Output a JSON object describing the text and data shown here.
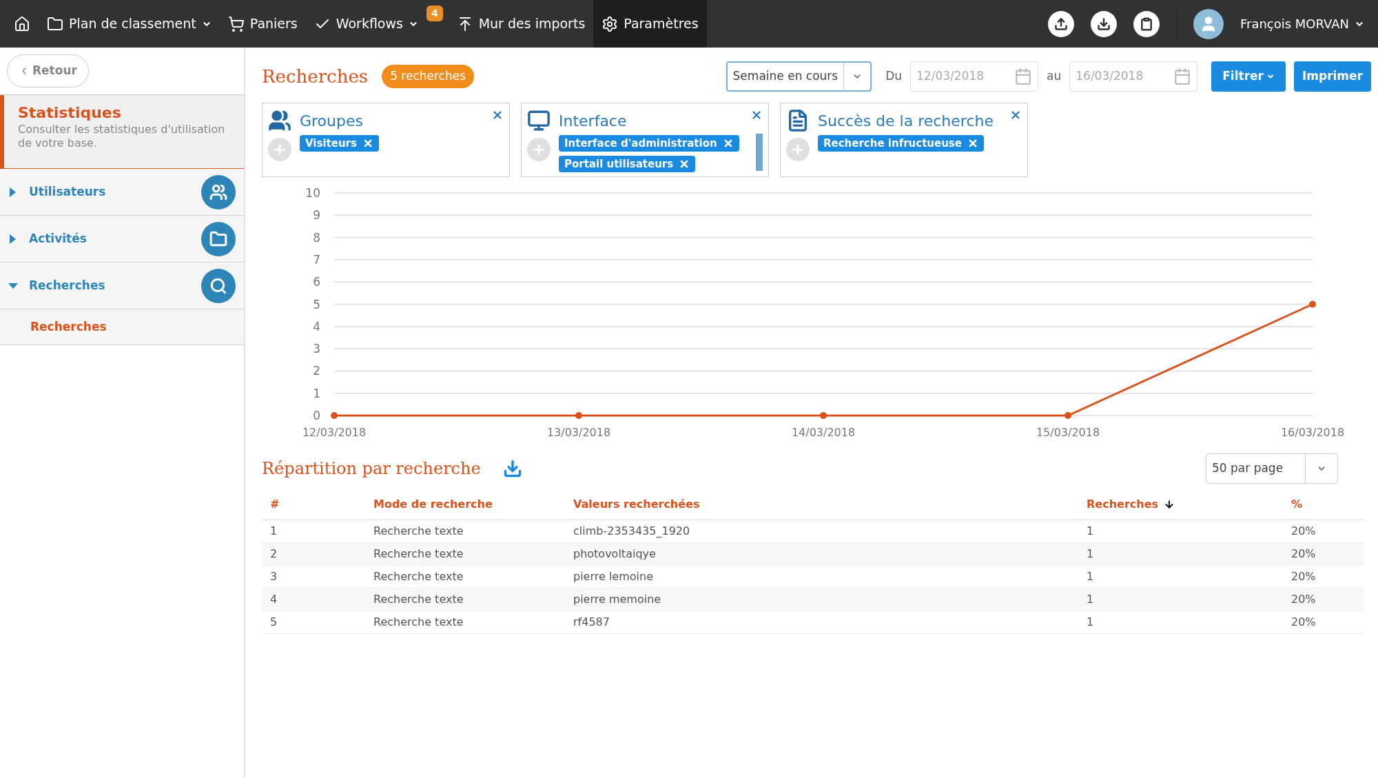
{
  "nav": {
    "items": [
      {
        "dropdown": false
      },
      {
        "label": "Plan de classement",
        "dropdown": true
      },
      {
        "label": "Paniers",
        "dropdown": false
      },
      {
        "label": "Workflows",
        "dropdown": true,
        "badge": "4"
      },
      {
        "label": "Mur des imports",
        "dropdown": false
      },
      {
        "label": "Paramètres",
        "dropdown": false,
        "selected": true
      }
    ],
    "user": "François MORVAN"
  },
  "sidebar": {
    "back": "Retour",
    "title": "Statistiques",
    "subtitle": "Consulter les statistiques d'utilisation de votre base.",
    "items": [
      {
        "label": "Utilisateurs",
        "expanded": false
      },
      {
        "label": "Activités",
        "expanded": false
      },
      {
        "label": "Recherches",
        "expanded": true,
        "children": [
          {
            "label": "Recherches",
            "selected": true
          }
        ]
      }
    ]
  },
  "header": {
    "title": "Recherches",
    "count": "5 recherches",
    "period": "Semaine en cours",
    "from_label": "Du",
    "from": "12/03/2018",
    "to_label": "au",
    "to": "16/03/2018",
    "filter": "Filtrer",
    "print": "Imprimer"
  },
  "filters": [
    {
      "title": "Groupes",
      "tags": [
        "Visiteurs"
      ]
    },
    {
      "title": "Interface",
      "tags": [
        "Interface d'administration",
        "Portail utilisateurs"
      ]
    },
    {
      "title": "Succès de la recherche",
      "tags": [
        "Recherche infructueuse"
      ]
    }
  ],
  "chart_data": {
    "type": "line",
    "grid": true,
    "categories": [
      "12/03/2018",
      "13/03/2018",
      "14/03/2018",
      "15/03/2018",
      "16/03/2018"
    ],
    "series": [
      {
        "color": "#d9531e",
        "marker": true,
        "values": [
          0,
          0,
          0,
          0,
          5
        ]
      }
    ],
    "ylim": [
      0,
      10
    ],
    "yticks": [
      0,
      1,
      2,
      3,
      4,
      5,
      6,
      7,
      8,
      9,
      10
    ]
  },
  "table": {
    "title": "Répartition par recherche",
    "page_size": "50 par page",
    "columns": [
      "#",
      "Mode de recherche",
      "Valeurs recherchées",
      "Recherches",
      "%"
    ],
    "rows": [
      [
        "1",
        "Recherche texte",
        "climb-2353435_1920",
        "1",
        "20%"
      ],
      [
        "2",
        "Recherche texte",
        "photovoltaiqye",
        "1",
        "20%"
      ],
      [
        "3",
        "Recherche texte",
        "pierre lemoine",
        "1",
        "20%"
      ],
      [
        "4",
        "Recherche texte",
        "pierre memoine",
        "1",
        "20%"
      ],
      [
        "5",
        "Recherche texte",
        "rf4587",
        "1",
        "20%"
      ]
    ]
  }
}
